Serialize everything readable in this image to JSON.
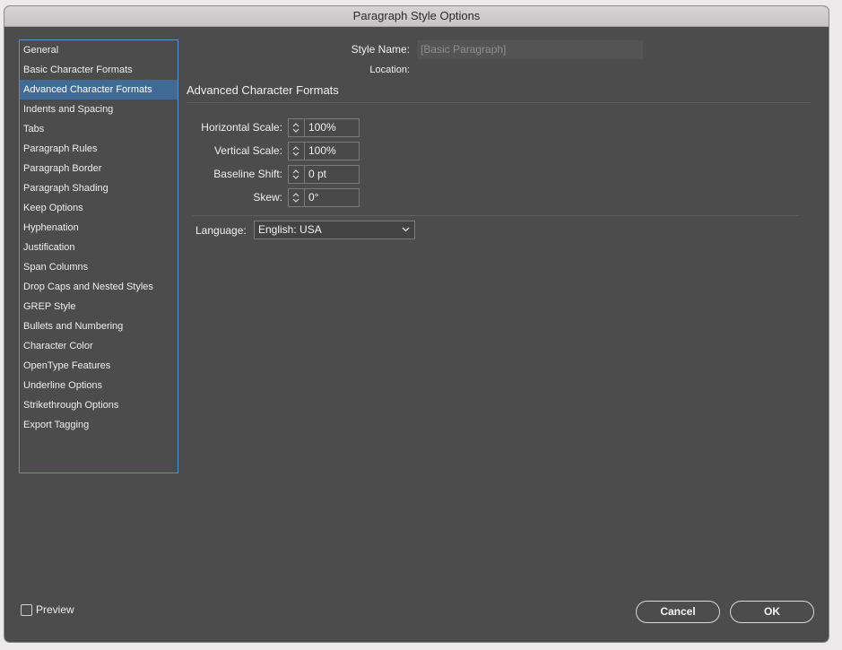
{
  "window": {
    "title": "Paragraph Style Options"
  },
  "sidebar": {
    "items": [
      {
        "label": "General"
      },
      {
        "label": "Basic Character Formats"
      },
      {
        "label": "Advanced Character Formats",
        "selected": true
      },
      {
        "label": "Indents and Spacing"
      },
      {
        "label": "Tabs"
      },
      {
        "label": "Paragraph Rules"
      },
      {
        "label": "Paragraph Border"
      },
      {
        "label": "Paragraph Shading"
      },
      {
        "label": "Keep Options"
      },
      {
        "label": "Hyphenation"
      },
      {
        "label": "Justification"
      },
      {
        "label": "Span Columns"
      },
      {
        "label": "Drop Caps and Nested Styles"
      },
      {
        "label": "GREP Style"
      },
      {
        "label": "Bullets and Numbering"
      },
      {
        "label": "Character Color"
      },
      {
        "label": "OpenType Features"
      },
      {
        "label": "Underline Options"
      },
      {
        "label": "Strikethrough Options"
      },
      {
        "label": "Export Tagging"
      }
    ]
  },
  "header": {
    "style_name_label": "Style Name:",
    "style_name_value": "[Basic Paragraph]",
    "location_label": "Location:"
  },
  "section": {
    "title": "Advanced Character Formats",
    "fields": {
      "horizontal_scale": {
        "label": "Horizontal Scale:",
        "value": "100%"
      },
      "vertical_scale": {
        "label": "Vertical Scale:",
        "value": "100%"
      },
      "baseline_shift": {
        "label": "Baseline Shift:",
        "value": "0 pt"
      },
      "skew": {
        "label": "Skew:",
        "value": "0°"
      }
    },
    "language": {
      "label": "Language:",
      "value": "English: USA"
    }
  },
  "footer": {
    "preview_label": "Preview",
    "preview_checked": false,
    "cancel_label": "Cancel",
    "ok_label": "OK"
  },
  "icons": {
    "spinner": "stepper-arrows-icon",
    "dropdown": "chevron-down-icon",
    "checkbox": "checkbox-icon"
  },
  "colors": {
    "background": "#4c4c4c",
    "selection": "#3f6b95",
    "sidebar_border": "#5a8fd0"
  }
}
